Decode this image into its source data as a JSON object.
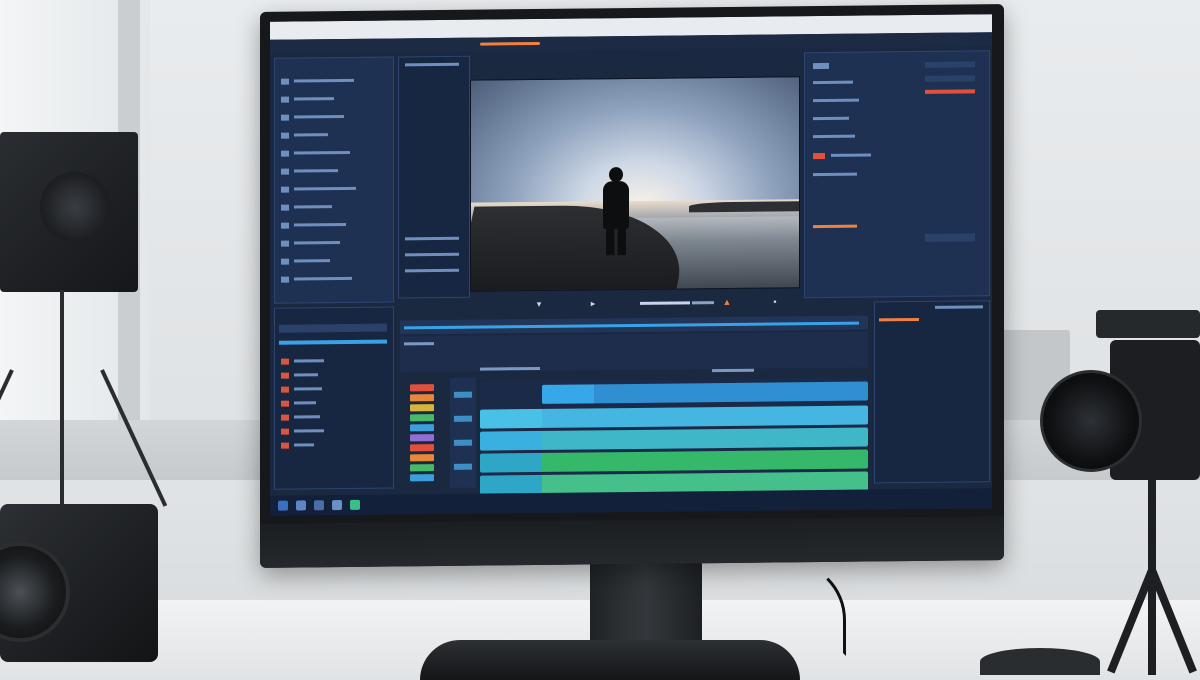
{
  "scene": {
    "description": "",
    "monitor_brand": "",
    "colors": {
      "accent": "#f0813f",
      "playhead": "#f05a45",
      "clip_blue": "#36a7e8",
      "clip_cyan": "#49c1e6",
      "clip_green": "#35b86a",
      "ui_bg": "#1a2840"
    }
  },
  "app": {
    "title": "",
    "menu": [
      "",
      "",
      "",
      "",
      ""
    ],
    "project_panel": {
      "header": "",
      "files": [
        "",
        "",
        "",
        "",
        "",
        "",
        "",
        "",
        "",
        "",
        "",
        ""
      ]
    },
    "effects_panel": {
      "header": "",
      "items": [
        "",
        "",
        "",
        "",
        "",
        "",
        "",
        "",
        "",
        ""
      ]
    },
    "preview": {
      "label": ""
    },
    "transport": {
      "timecode_in": "",
      "timecode_out": ""
    },
    "timeline": {
      "tracks": [
        "",
        "",
        "",
        "",
        ""
      ],
      "clips": [
        {
          "label": "",
          "color": "#36a7e8"
        },
        {
          "label": "",
          "color": "#49c1e6"
        },
        {
          "label": "",
          "color": "#3ab0e0"
        },
        {
          "label": "",
          "color": "#35b86a"
        },
        {
          "label": "",
          "color": "#3fc28a"
        }
      ]
    },
    "inspector": {
      "rows": [
        "",
        "",
        "",
        "",
        "",
        "",
        "",
        ""
      ]
    },
    "taskbar": {
      "clock": ""
    }
  }
}
